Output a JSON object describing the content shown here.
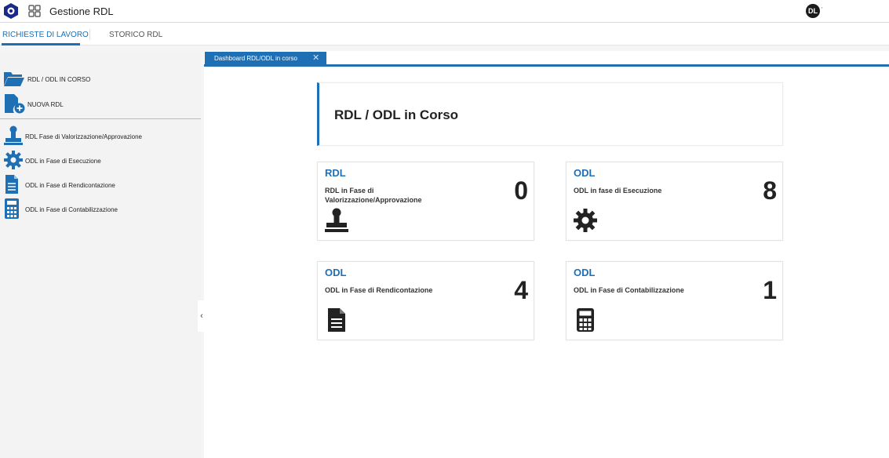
{
  "header": {
    "logo_icon": "hexagon-logo-icon",
    "apps_icon": "app-grid-icon",
    "app_title": "Gestione RDL",
    "avatar_initials": "DL",
    "avatar_caret": "'"
  },
  "tabs": [
    {
      "label": "RICHIESTE DI LAVORO",
      "active": true
    },
    {
      "label": "STORICO RDL",
      "active": false
    }
  ],
  "sidebar": {
    "items": [
      {
        "label": "RDL / ODL IN CORSO",
        "icon": "folder-open-icon"
      },
      {
        "label": "NUOVA RDL",
        "icon": "new-document-icon"
      },
      {
        "label": "RDL Fase di Valorizzazione/Approvazione",
        "icon": "stamp-icon"
      },
      {
        "label": "ODL in Fase di Esecuzione",
        "icon": "gear-icon"
      },
      {
        "label": "ODL in Fase di Rendicontazione",
        "icon": "document-icon"
      },
      {
        "label": "ODL in Fase di Contabilizzazione",
        "icon": "calculator-icon"
      }
    ],
    "collapse_glyph": "‹"
  },
  "doc_tab": {
    "label": "Dashboard RDL/ODL in corso",
    "close": "✕"
  },
  "dashboard": {
    "title": "RDL / ODL in Corso",
    "cards": [
      {
        "type": "RDL",
        "description": "RDL in Fase di Valorizzazione/Approvazione",
        "count": "0",
        "icon": "stamp-icon"
      },
      {
        "type": "ODL",
        "description": "ODL in fase di Esecuzione",
        "count": "8",
        "icon": "gear-icon"
      },
      {
        "type": "ODL",
        "description": "ODL in Fase di Rendicontazione",
        "count": "4",
        "icon": "document-icon"
      },
      {
        "type": "ODL",
        "description": "ODL in Fase di Contabilizzazione",
        "count": "1",
        "icon": "calculator-icon"
      }
    ]
  },
  "colors": {
    "accent": "#1f6fb5",
    "dark": "#222222"
  }
}
